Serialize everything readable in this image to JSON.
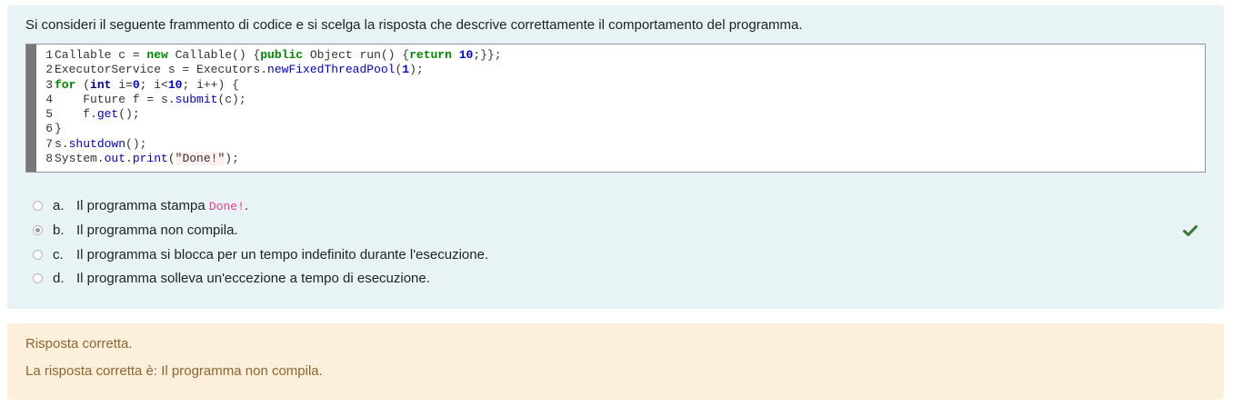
{
  "question": {
    "text": "Si consideri il seguente frammento di codice e si scelga la risposta che descrive correttamente il comportamento del programma."
  },
  "code": {
    "line_numbers": [
      "1",
      "2",
      "3",
      "4",
      "5",
      "6",
      "7",
      "8"
    ],
    "lines": [
      [
        {
          "t": "Callable c = ",
          "c": ""
        },
        {
          "t": "new",
          "c": "kw"
        },
        {
          "t": " Callable() {",
          "c": ""
        },
        {
          "t": "public",
          "c": "kw"
        },
        {
          "t": " Object run() {",
          "c": ""
        },
        {
          "t": "return",
          "c": "kw"
        },
        {
          "t": " ",
          "c": ""
        },
        {
          "t": "10",
          "c": "num"
        },
        {
          "t": ";}};",
          "c": ""
        }
      ],
      [
        {
          "t": "ExecutorService s = Executors.",
          "c": ""
        },
        {
          "t": "newFixedThreadPool",
          "c": "fn"
        },
        {
          "t": "(",
          "c": ""
        },
        {
          "t": "1",
          "c": "num"
        },
        {
          "t": ");",
          "c": ""
        }
      ],
      [
        {
          "t": "for",
          "c": "kw"
        },
        {
          "t": " (",
          "c": ""
        },
        {
          "t": "int",
          "c": "ty"
        },
        {
          "t": " i=",
          "c": ""
        },
        {
          "t": "0",
          "c": "num"
        },
        {
          "t": "; i<",
          "c": ""
        },
        {
          "t": "10",
          "c": "num"
        },
        {
          "t": "; i++) {",
          "c": ""
        }
      ],
      [
        {
          "t": "    Future f = s.",
          "c": ""
        },
        {
          "t": "submit",
          "c": "fn"
        },
        {
          "t": "(c);",
          "c": ""
        }
      ],
      [
        {
          "t": "    f.",
          "c": ""
        },
        {
          "t": "get",
          "c": "fn"
        },
        {
          "t": "();",
          "c": ""
        }
      ],
      [
        {
          "t": "}",
          "c": ""
        }
      ],
      [
        {
          "t": "s.",
          "c": ""
        },
        {
          "t": "shutdown",
          "c": "fn"
        },
        {
          "t": "();",
          "c": ""
        }
      ],
      [
        {
          "t": "System.",
          "c": ""
        },
        {
          "t": "out",
          "c": "fn"
        },
        {
          "t": ".",
          "c": ""
        },
        {
          "t": "print",
          "c": "fn"
        },
        {
          "t": "(",
          "c": ""
        },
        {
          "t": "\"Done!\"",
          "c": "str"
        },
        {
          "t": ");",
          "c": ""
        }
      ]
    ]
  },
  "answers": [
    {
      "letter": "a.",
      "text_before": "Il programma stampa ",
      "code": "Done!",
      "text_after": ".",
      "selected": false
    },
    {
      "letter": "b.",
      "text": "Il programma non compila.",
      "selected": true,
      "correct": true
    },
    {
      "letter": "c.",
      "text": "Il programma si blocca per un tempo indefinito durante l'esecuzione.",
      "selected": false
    },
    {
      "letter": "d.",
      "text": "Il programma solleva un'eccezione a tempo di esecuzione.",
      "selected": false
    }
  ],
  "feedback": {
    "status": "Risposta corretta.",
    "right_answer": "La risposta corretta è: Il programma non compila."
  },
  "icons": {
    "correct": "check-icon"
  },
  "colors": {
    "question_bg": "#e7f3f5",
    "feedback_bg": "#fcefdc",
    "feedback_text": "#8e662e",
    "check": "#357a32",
    "code_border": "#8f959e",
    "gutter": "#777777"
  }
}
